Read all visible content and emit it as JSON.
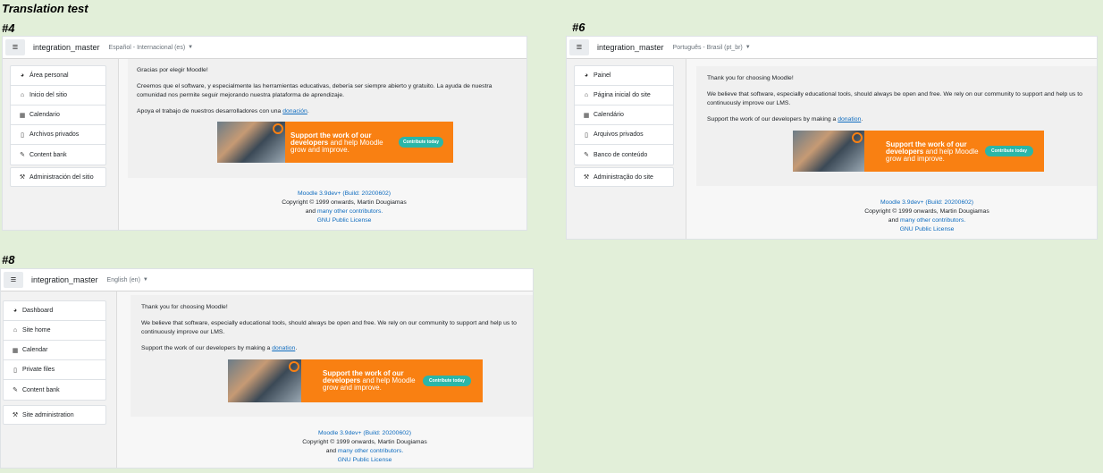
{
  "page_title": "Translation test",
  "panels": [
    {
      "label": "#4",
      "site_name": "integration_master",
      "language": "Español - Internacional (es)",
      "nav_items": [
        "Área personal",
        "Inicio del sitio",
        "Calendario",
        "Archivos privados",
        "Content bank"
      ],
      "admin_item": "Administración del sitio",
      "thanks": "Gracias por elegir Moodle!",
      "belief": "Creemos que el software, y especialmente las herramientas educativas, debería ser siempre abierto y gratuito. La ayuda de nuestra comunidad nos permite seguir mejorando nuestra plataforma de aprendizaje.",
      "support_prefix": "Apoya el trabajo de nuestros desarrolladores con una",
      "support_link": "donación",
      "support_suffix": ".",
      "footer_version": "Moodle 3.9dev+ (Build: 20200602)",
      "footer_copyright": "Copyright © 1999 onwards, Martin Dougiamas",
      "footer_and": "and",
      "footer_contributors": "many other contributors.",
      "footer_license": "GNU Public License"
    },
    {
      "label": "#6",
      "site_name": "integration_master",
      "language": "Português - Brasil (pt_br)",
      "nav_items": [
        "Painel",
        "Página inicial do site",
        "Calendário",
        "Arquivos privados",
        "Banco de conteúdo"
      ],
      "admin_item": "Administração do site",
      "thanks": "Thank you for choosing Moodle!",
      "belief": "We believe that software, especially educational tools, should always be open and free. We rely on our community to support and help us to continuously improve our LMS.",
      "support_prefix": "Support the work of our developers by making a",
      "support_link": "donation",
      "support_suffix": ".",
      "footer_version": "Moodle 3.9dev+ (Build: 20200602)",
      "footer_copyright": "Copyright © 1999 onwards, Martin Dougiamas",
      "footer_and": "and",
      "footer_contributors": "many other contributors.",
      "footer_license": "GNU Public License"
    },
    {
      "label": "#8",
      "site_name": "integration_master",
      "language": "English (en)",
      "nav_items": [
        "Dashboard",
        "Site home",
        "Calendar",
        "Private files",
        "Content bank"
      ],
      "admin_item": "Site administration",
      "thanks": "Thank you for choosing Moodle!",
      "belief": "We believe that software, especially educational tools, should always be open and free. We rely on our community to support and help us to continuously improve our LMS.",
      "support_prefix": "Support the work of our developers by making a",
      "support_link": "donation",
      "support_suffix": ".",
      "footer_version": "Moodle 3.9dev+ (Build: 20200602)",
      "footer_copyright": "Copyright © 1999 onwards, Martin Dougiamas",
      "footer_and": "and",
      "footer_contributors": "many other contributors.",
      "footer_license": "GNU Public License"
    }
  ],
  "banner": {
    "line1": "Support the work of our",
    "line2_bold": "developers",
    "line2_rest": " and help Moodle",
    "line3": "grow and improve.",
    "button": "Contribute today"
  },
  "icons": [
    "dashboard-icon",
    "home-icon",
    "calendar-icon",
    "file-icon",
    "pen-icon",
    "wrench-icon",
    "menu-icon",
    "caret-down-icon"
  ],
  "colors": {
    "background": "#e2efd9",
    "link": "#0f6cbf",
    "banner_orange": "#f98012",
    "button_teal": "#2bb6a8"
  }
}
